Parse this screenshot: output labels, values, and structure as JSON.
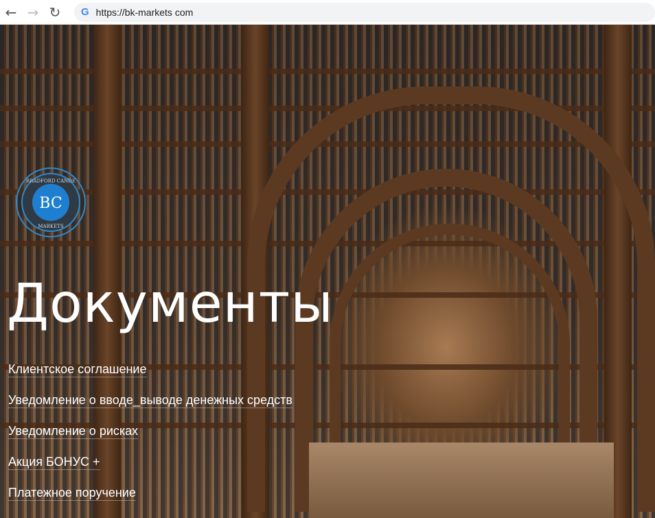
{
  "browser": {
    "url": "https://bk-markets com"
  },
  "logo": {
    "top_text": "BRADFORD CANDE",
    "bottom_text": "MARKETS",
    "monogram": "BC"
  },
  "page": {
    "title": "Документы",
    "links": [
      "Клиентское соглашение",
      "Уведомление о вводе_выводе денежных средств",
      "Уведомление о рисках",
      "Акция БОНУС +",
      "Платежное поручение"
    ]
  }
}
